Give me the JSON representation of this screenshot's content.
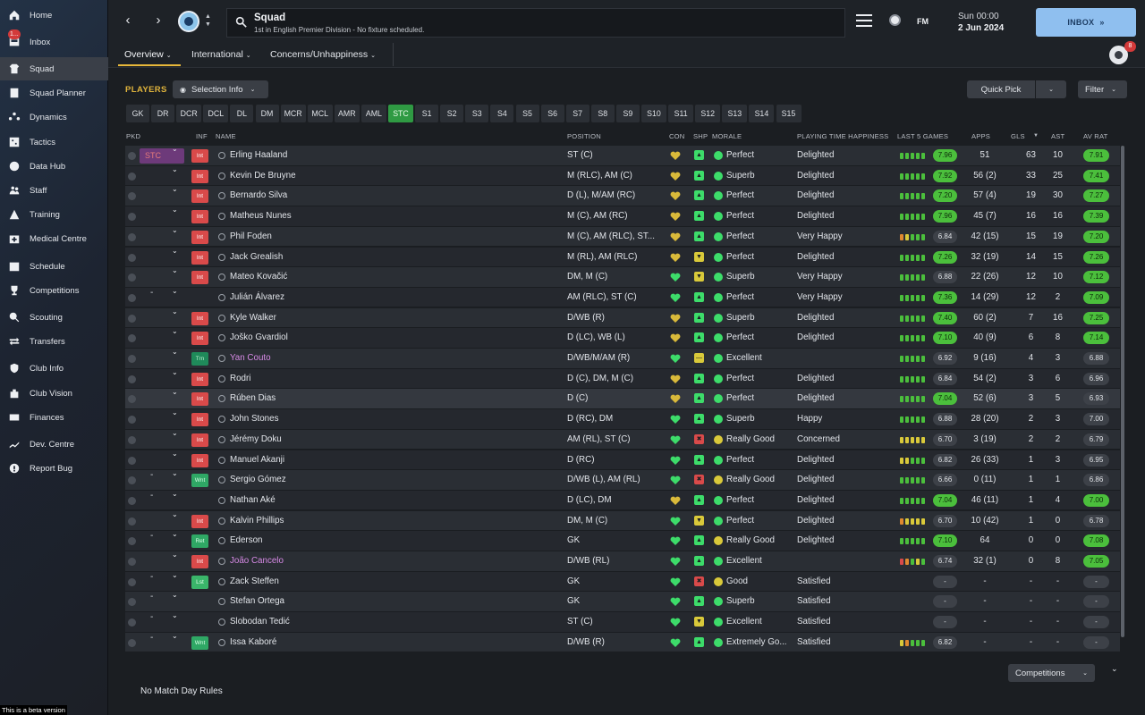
{
  "sidebar": {
    "items": [
      {
        "label": "Home",
        "icon": "home-icon"
      },
      {
        "label": "Inbox",
        "icon": "inbox-icon",
        "badge": "1..."
      },
      {
        "label": "Squad",
        "icon": "shirt-icon"
      },
      {
        "label": "Squad Planner",
        "icon": "planner-icon"
      },
      {
        "label": "Dynamics",
        "icon": "dynamics-icon"
      },
      {
        "label": "Tactics",
        "icon": "tactics-icon"
      },
      {
        "label": "Data Hub",
        "icon": "data-hub-icon"
      },
      {
        "label": "Staff",
        "icon": "staff-icon"
      },
      {
        "label": "Training",
        "icon": "training-icon"
      },
      {
        "label": "Medical Centre",
        "icon": "medical-icon"
      },
      {
        "label": "Schedule",
        "icon": "calendar-icon"
      },
      {
        "label": "Competitions",
        "icon": "trophy-icon"
      },
      {
        "label": "Scouting",
        "icon": "search-icon"
      },
      {
        "label": "Transfers",
        "icon": "transfer-icon"
      },
      {
        "label": "Club Info",
        "icon": "shield-icon"
      },
      {
        "label": "Club Vision",
        "icon": "vision-icon"
      },
      {
        "label": "Finances",
        "icon": "finances-icon"
      },
      {
        "label": "Dev. Centre",
        "icon": "dev-centre-icon"
      },
      {
        "label": "Report Bug",
        "icon": "bug-icon"
      }
    ],
    "beta_note": "This is a beta version"
  },
  "header": {
    "title": "Squad",
    "subtitle": "1st in English Premier Division - No fixture scheduled.",
    "fm_logo": "FM",
    "date_day": "Sun 00:00",
    "date": "2 Jun 2024",
    "inbox_label": "INBOX",
    "inbox_arrows": "»",
    "avatar_badge": "8"
  },
  "subnav": {
    "tabs": [
      {
        "label": "Overview"
      },
      {
        "label": "International"
      },
      {
        "label": "Concerns/Unhappiness"
      }
    ]
  },
  "toolbar": {
    "players_label": "PLAYERS",
    "selection_info": "Selection Info",
    "quick_pick": "Quick Pick",
    "filter": "Filter",
    "positions": [
      "GK",
      "DR",
      "DCR",
      "DCL",
      "DL",
      "DM",
      "MCR",
      "MCL",
      "AMR",
      "AML",
      "STC",
      "S1",
      "S2",
      "S3",
      "S4",
      "S5",
      "S6",
      "S7",
      "S8",
      "S9",
      "S10",
      "S11",
      "S12",
      "S13",
      "S14",
      "S15"
    ],
    "active_position": "STC"
  },
  "table": {
    "headers": {
      "pkd": "PKD",
      "inf": "INF",
      "name": "NAME",
      "position": "POSITION",
      "con": "CON",
      "shp": "SHP",
      "morale": "MORALE",
      "pth": "PLAYING TIME HAPPINESS",
      "last5": "LAST 5 GAMES",
      "apps": "APPS",
      "gls": "GLS",
      "ast": "AST",
      "avrat": "AV RAT"
    },
    "rows": [
      {
        "pkd": "STC",
        "inf": "Int",
        "name": "Erling Haaland",
        "position": "ST (C)",
        "shp": "green",
        "morale": "Perfect",
        "mor": "green",
        "pth": "Delighted",
        "l5": "ggggg",
        "l5r": "7.96",
        "l5c": "green",
        "apps": "51",
        "gls": "63",
        "ast": "10",
        "avr": "7.91",
        "avc": "green",
        "con": "y"
      },
      {
        "pkd": "",
        "inf": "Int",
        "name": "Kevin De Bruyne",
        "position": "M (RLC), AM (C)",
        "shp": "green",
        "morale": "Superb",
        "mor": "green",
        "pth": "Delighted",
        "l5": "ggggg",
        "l5r": "7.92",
        "l5c": "green",
        "apps": "56 (2)",
        "gls": "33",
        "ast": "25",
        "avr": "7.41",
        "avc": "green",
        "con": "y"
      },
      {
        "pkd": "",
        "inf": "Int",
        "name": "Bernardo Silva",
        "position": "D (L), M/AM (RC)",
        "shp": "green",
        "morale": "Perfect",
        "mor": "green",
        "pth": "Delighted",
        "l5": "ggggg",
        "l5r": "7.20",
        "l5c": "green",
        "apps": "57 (4)",
        "gls": "19",
        "ast": "30",
        "avr": "7.27",
        "avc": "green",
        "con": "y"
      },
      {
        "pkd": "",
        "inf": "Int",
        "name": "Matheus Nunes",
        "position": "M (C), AM (RC)",
        "shp": "green",
        "morale": "Perfect",
        "mor": "green",
        "pth": "Delighted",
        "l5": "ggggg",
        "l5r": "7.96",
        "l5c": "green",
        "apps": "45 (7)",
        "gls": "16",
        "ast": "16",
        "avr": "7.39",
        "avc": "green",
        "con": "y"
      },
      {
        "pkd": "",
        "inf": "Int",
        "name": "Phil Foden",
        "position": "M (C), AM (RLC), ST...",
        "shp": "green",
        "morale": "Perfect",
        "mor": "green",
        "pth": "Very Happy",
        "l5": "oyggg",
        "l5r": "6.84",
        "l5c": "grey",
        "apps": "42 (15)",
        "gls": "15",
        "ast": "19",
        "avr": "7.20",
        "avc": "green",
        "con": "y"
      },
      {
        "pkd": "",
        "inf": "Int",
        "name": "Jack Grealish",
        "position": "M (RL), AM (RLC)",
        "shp": "yellow",
        "morale": "Perfect",
        "mor": "green",
        "pth": "Delighted",
        "l5": "ggggg",
        "l5r": "7.26",
        "l5c": "green",
        "apps": "32 (19)",
        "gls": "14",
        "ast": "15",
        "avr": "7.26",
        "avc": "green",
        "con": "y"
      },
      {
        "pkd": "",
        "inf": "Int",
        "name": "Mateo Kovačić",
        "position": "DM, M (C)",
        "shp": "yellow",
        "morale": "Superb",
        "mor": "green",
        "pth": "Very Happy",
        "l5": "ggggg",
        "l5r": "6.88",
        "l5c": "grey",
        "apps": "22 (26)",
        "gls": "12",
        "ast": "10",
        "avr": "7.12",
        "avc": "green",
        "con": "g"
      },
      {
        "pkd": "-",
        "inf": "",
        "name": "Julián Álvarez",
        "position": "AM (RLC), ST (C)",
        "shp": "green",
        "morale": "Perfect",
        "mor": "green",
        "pth": "Very Happy",
        "l5": "ggggg",
        "l5r": "7.36",
        "l5c": "green",
        "apps": "14 (29)",
        "gls": "12",
        "ast": "2",
        "avr": "7.09",
        "avc": "green",
        "con": "g"
      },
      {
        "pkd": "",
        "inf": "Int",
        "name": "Kyle Walker",
        "position": "D/WB (R)",
        "shp": "green",
        "morale": "Superb",
        "mor": "green",
        "pth": "Delighted",
        "l5": "ggggg",
        "l5r": "7.40",
        "l5c": "green",
        "apps": "60 (2)",
        "gls": "7",
        "ast": "16",
        "avr": "7.25",
        "avc": "green",
        "con": "y"
      },
      {
        "pkd": "",
        "inf": "Int",
        "name": "Joško Gvardiol",
        "position": "D (LC), WB (L)",
        "shp": "green",
        "morale": "Perfect",
        "mor": "green",
        "pth": "Delighted",
        "l5": "ggggg",
        "l5r": "7.10",
        "l5c": "green",
        "apps": "40 (9)",
        "gls": "6",
        "ast": "8",
        "avr": "7.14",
        "avc": "green",
        "con": "y"
      },
      {
        "pkd": "",
        "inf": "Trn",
        "name": "Yan Couto",
        "position": "D/WB/M/AM (R)",
        "shp": "yellowdash",
        "morale": "Excellent",
        "mor": "green",
        "pth": "",
        "l5": "ggggg",
        "l5r": "6.92",
        "l5c": "grey",
        "apps": "9 (16)",
        "gls": "4",
        "ast": "3",
        "avr": "6.88",
        "avc": "grey",
        "con": "g",
        "loan": true
      },
      {
        "pkd": "",
        "inf": "Int",
        "name": "Rodri",
        "position": "D (C), DM, M (C)",
        "shp": "green",
        "morale": "Perfect",
        "mor": "green",
        "pth": "Delighted",
        "l5": "ggggg",
        "l5r": "6.84",
        "l5c": "grey",
        "apps": "54 (2)",
        "gls": "3",
        "ast": "6",
        "avr": "6.96",
        "avc": "grey",
        "con": "y"
      },
      {
        "pkd": "",
        "inf": "Int",
        "name": "Rúben Dias",
        "position": "D (C)",
        "shp": "green",
        "morale": "Perfect",
        "mor": "green",
        "pth": "Delighted",
        "l5": "ggggg",
        "l5r": "7.04",
        "l5c": "green",
        "apps": "52 (6)",
        "gls": "3",
        "ast": "5",
        "avr": "6.93",
        "avc": "grey",
        "con": "y",
        "hl": true
      },
      {
        "pkd": "",
        "inf": "Int",
        "name": "John Stones",
        "position": "D (RC), DM",
        "shp": "green",
        "morale": "Superb",
        "mor": "green",
        "pth": "Happy",
        "l5": "ggggg",
        "l5r": "6.88",
        "l5c": "grey",
        "apps": "28 (20)",
        "gls": "2",
        "ast": "3",
        "avr": "7.00",
        "avc": "grey",
        "con": "g"
      },
      {
        "pkd": "",
        "inf": "Int",
        "name": "Jérémy Doku",
        "position": "AM (RL), ST (C)",
        "shp": "red",
        "morale": "Really Good",
        "mor": "yellow",
        "pth": "Concerned",
        "l5": "yyyyy",
        "l5r": "6.70",
        "l5c": "grey",
        "apps": "3 (19)",
        "gls": "2",
        "ast": "2",
        "avr": "6.79",
        "avc": "grey",
        "con": "g"
      },
      {
        "pkd": "",
        "inf": "Int",
        "name": "Manuel Akanji",
        "position": "D (RC)",
        "shp": "green",
        "morale": "Perfect",
        "mor": "green",
        "pth": "Delighted",
        "l5": "yyggg",
        "l5r": "6.82",
        "l5c": "grey",
        "apps": "26 (33)",
        "gls": "1",
        "ast": "3",
        "avr": "6.95",
        "avc": "grey",
        "con": "g"
      },
      {
        "pkd": "-",
        "inf": "Wnt",
        "name": "Sergio Gómez",
        "position": "D/WB (L), AM (RL)",
        "shp": "red",
        "morale": "Really Good",
        "mor": "yellow",
        "pth": "Delighted",
        "l5": "ggggg",
        "l5r": "6.66",
        "l5c": "grey",
        "apps": "0 (11)",
        "gls": "1",
        "ast": "1",
        "avr": "6.86",
        "avc": "grey",
        "con": "g"
      },
      {
        "pkd": "-",
        "inf": "",
        "name": "Nathan Aké",
        "position": "D (LC), DM",
        "shp": "green",
        "morale": "Perfect",
        "mor": "green",
        "pth": "Delighted",
        "l5": "ggggg",
        "l5r": "7.04",
        "l5c": "green",
        "apps": "46 (11)",
        "gls": "1",
        "ast": "4",
        "avr": "7.00",
        "avc": "green",
        "con": "y"
      },
      {
        "pkd": "",
        "inf": "Int",
        "name": "Kalvin Phillips",
        "position": "DM, M (C)",
        "shp": "yellow",
        "morale": "Perfect",
        "mor": "green",
        "pth": "Delighted",
        "l5": "oyyyy",
        "l5r": "6.70",
        "l5c": "grey",
        "apps": "10 (42)",
        "gls": "1",
        "ast": "0",
        "avr": "6.78",
        "avc": "grey",
        "con": "g"
      },
      {
        "pkd": "-",
        "inf": "Ret",
        "name": "Ederson",
        "position": "GK",
        "shp": "green",
        "morale": "Really Good",
        "mor": "yellow",
        "pth": "Delighted",
        "l5": "ggggg",
        "l5r": "7.10",
        "l5c": "green",
        "apps": "64",
        "gls": "0",
        "ast": "0",
        "avr": "7.08",
        "avc": "green",
        "con": "g"
      },
      {
        "pkd": "",
        "inf": "Int",
        "name": "João Cancelo",
        "position": "D/WB (RL)",
        "shp": "green",
        "morale": "Excellent",
        "mor": "green",
        "pth": "",
        "l5": "rogyg",
        "l5r": "6.74",
        "l5c": "grey",
        "apps": "32 (1)",
        "gls": "0",
        "ast": "8",
        "avr": "7.05",
        "avc": "green",
        "con": "g",
        "loan": true
      },
      {
        "pkd": "-",
        "inf": "Lst",
        "name": "Zack Steffen",
        "position": "GK",
        "shp": "red",
        "morale": "Good",
        "mor": "yellow",
        "pth": "Satisfied",
        "l5": "",
        "l5r": "-",
        "l5c": "grey",
        "apps": "-",
        "gls": "-",
        "ast": "-",
        "avr": "-",
        "avc": "grey",
        "con": "g"
      },
      {
        "pkd": "-",
        "inf": "",
        "name": "Stefan Ortega",
        "position": "GK",
        "shp": "green",
        "morale": "Superb",
        "mor": "green",
        "pth": "Satisfied",
        "l5": "",
        "l5r": "-",
        "l5c": "grey",
        "apps": "-",
        "gls": "-",
        "ast": "-",
        "avr": "-",
        "avc": "grey",
        "con": "g"
      },
      {
        "pkd": "-",
        "inf": "",
        "name": "Slobodan Tedić",
        "position": "ST (C)",
        "shp": "yellow",
        "morale": "Excellent",
        "mor": "green",
        "pth": "Satisfied",
        "l5": "",
        "l5r": "-",
        "l5c": "grey",
        "apps": "-",
        "gls": "-",
        "ast": "-",
        "avr": "-",
        "avc": "grey",
        "con": "g"
      },
      {
        "pkd": "-",
        "inf": "Wnt",
        "name": "Issa Kaboré",
        "position": "D/WB (R)",
        "shp": "green",
        "morale": "Extremely Go...",
        "mor": "green",
        "pth": "Satisfied",
        "l5": "yoggg",
        "l5r": "6.82",
        "l5c": "grey",
        "apps": "-",
        "gls": "-",
        "ast": "-",
        "avr": "-",
        "avc": "grey",
        "con": "g"
      }
    ]
  },
  "footer": {
    "competitions": "Competitions",
    "no_match_day_rules": "No Match Day Rules"
  },
  "colors": {
    "accent_gold": "#e8b83a",
    "rating_green": "#4bbf3c",
    "inbox_blue": "#8fbfef",
    "injury_red": "#d94a4a"
  }
}
